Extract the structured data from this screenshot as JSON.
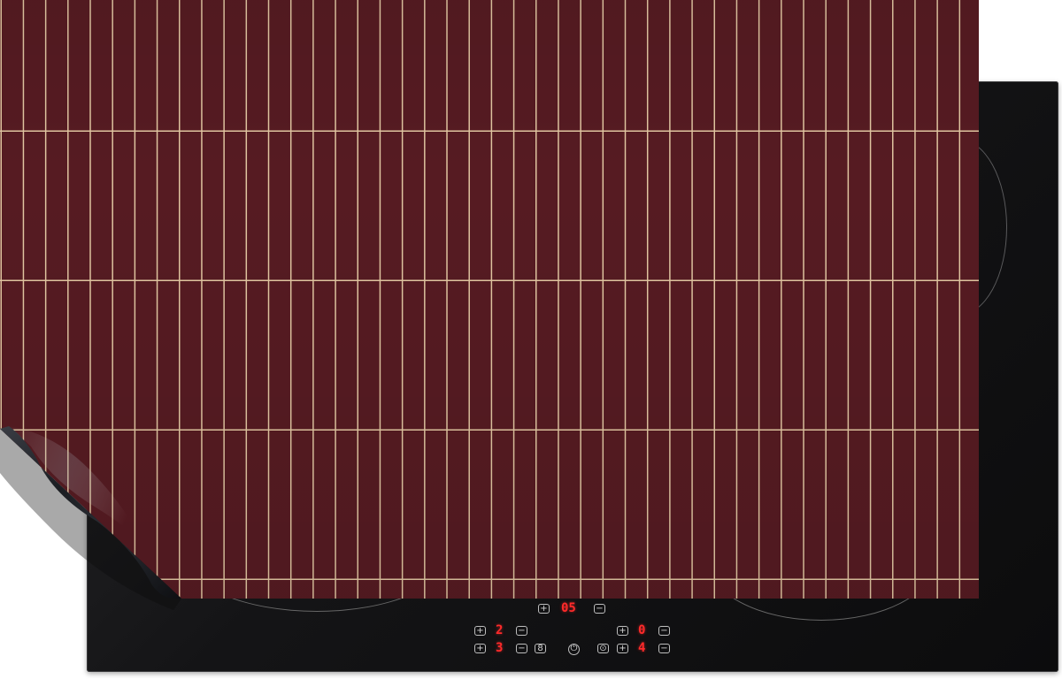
{
  "scene": {
    "mat_color": "#561b22",
    "grout_color": "#e2c7a2",
    "hob_color": "#141416"
  },
  "controls": {
    "plus_symbol": "+",
    "minus_symbol": "−",
    "timer_value": "05",
    "zone_left_value": "2",
    "zone_right_value": "0",
    "zone_rear_left_value": "3",
    "zone_rear_right_value": "4",
    "lock_symbol": "8",
    "power_symbol": "⏻",
    "key_symbol": "⊙"
  }
}
